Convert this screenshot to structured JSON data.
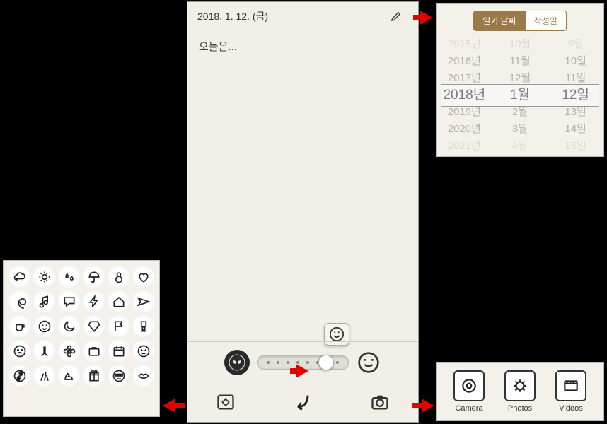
{
  "diary": {
    "date_line": "2018. 1. 12. (금)",
    "body_text": "오늘은..."
  },
  "date_picker": {
    "tab_active": "일기 날짜",
    "tab_inactive": "작성일",
    "years": [
      "2015년",
      "2016년",
      "2017년",
      "2018년",
      "2019년",
      "2020년",
      "2021년"
    ],
    "months": [
      "10월",
      "11월",
      "12월",
      "1월",
      "2월",
      "3월",
      "4월"
    ],
    "days": [
      "9일",
      "10일",
      "11일",
      "12일",
      "13일",
      "14일",
      "15일"
    ],
    "selected_index": 3
  },
  "media": {
    "camera": "Camera",
    "photos": "Photos",
    "videos": "Videos"
  },
  "stickers": [
    "cloud",
    "sun",
    "water-drops",
    "umbrella",
    "snowman",
    "heart",
    "swirl",
    "music-note",
    "speech-bubble",
    "lightning",
    "house",
    "airplane",
    "coffee-cup",
    "face-amused",
    "moon",
    "diamond",
    "flag",
    "trophy",
    "face-sad",
    "praying-hands",
    "flower",
    "briefcase",
    "calendar",
    "face-annoyed",
    "yin-yang",
    "paint-brushes",
    "arm-flex",
    "gift",
    "face-cool",
    "lips"
  ],
  "mood_slider": {
    "value": 6,
    "max": 8
  }
}
